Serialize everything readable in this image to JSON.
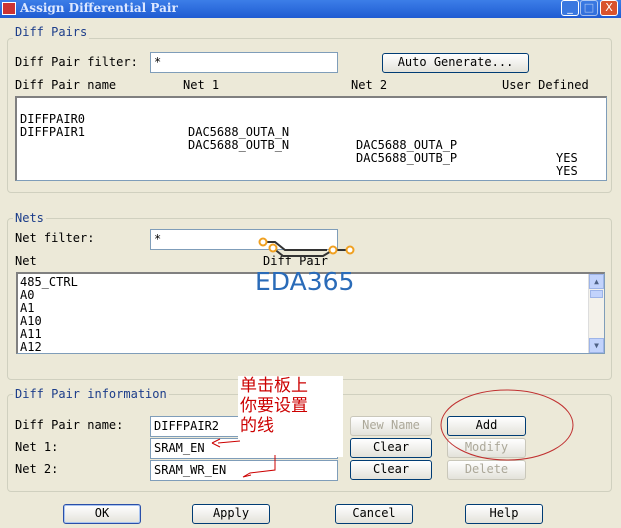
{
  "window": {
    "title": "Assign Differential Pair",
    "minimize": "_",
    "maximize": "□",
    "close": "X"
  },
  "diff_pairs": {
    "group_label": "Diff Pairs",
    "filter_label": "Diff Pair filter:",
    "filter_value": "*",
    "auto_generate": "Auto Generate...",
    "columns": [
      "Diff Pair name",
      "Net 1",
      "Net 2",
      "User Defined"
    ],
    "rows": [
      [
        "DIFFPAIR0",
        "DAC5688_OUTA_N",
        "DAC5688_OUTA_P",
        "YES"
      ],
      [
        "DIFFPAIR1",
        "DAC5688_OUTB_N",
        "DAC5688_OUTB_P",
        "YES"
      ]
    ]
  },
  "nets": {
    "group_label": "Nets",
    "filter_label": "Net filter:",
    "filter_value": "*",
    "columns": [
      "Net",
      "Diff Pair"
    ],
    "items": [
      "485_CTRL",
      "A0",
      "A1",
      "A10",
      "A11",
      "A12"
    ]
  },
  "info": {
    "group_label": "Diff Pair information",
    "name_label": "Diff Pair name:",
    "name_value": "DIFFPAIR2",
    "net1_label": "Net 1:",
    "net1_value": "SRAM_EN",
    "net2_label": "Net 2:",
    "net2_value": "SRAM_WR_EN",
    "new_name": "New Name",
    "clear1": "Clear",
    "clear2": "Clear",
    "add": "Add",
    "modify": "Modify",
    "delete": "Delete"
  },
  "buttons": {
    "ok": "OK",
    "apply": "Apply",
    "cancel": "Cancel",
    "help": "Help"
  },
  "annotation": {
    "line1": "单击板上",
    "line2": "你要设置",
    "line3": "的线",
    "color": "#cc0000"
  },
  "watermark": "EDA365"
}
